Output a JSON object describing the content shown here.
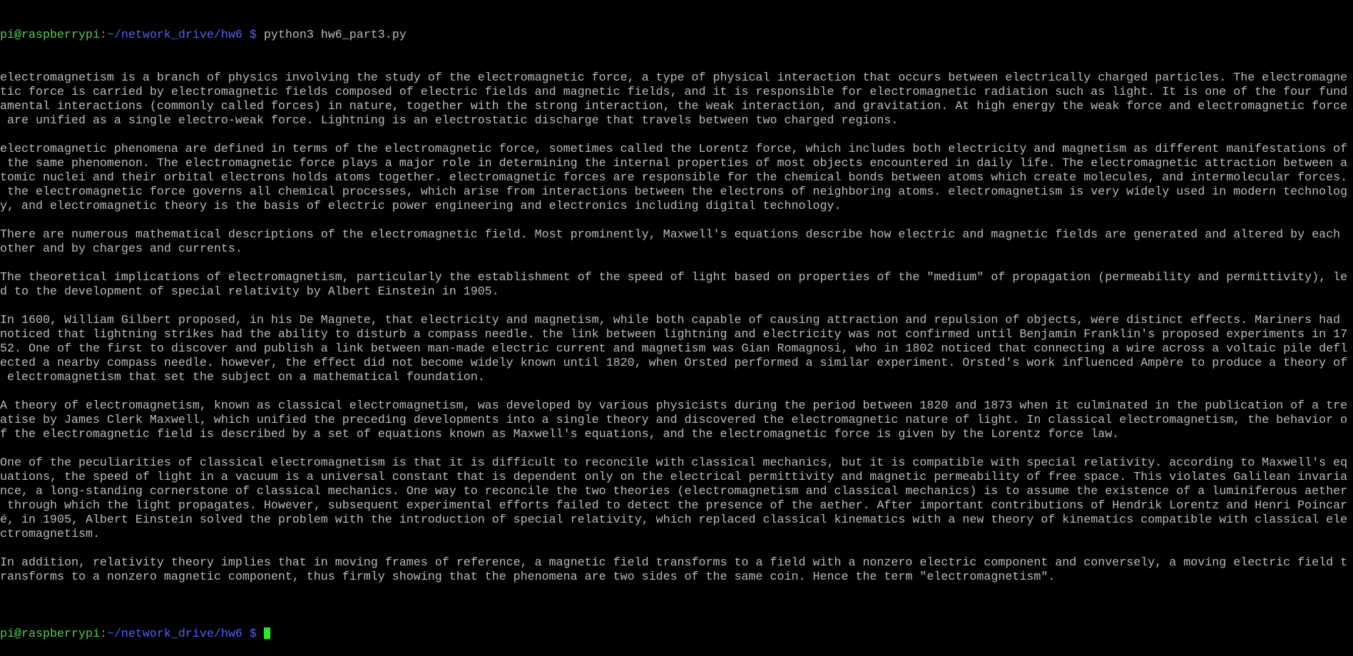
{
  "prompt": {
    "user_host": "pi@raspberrypi",
    "colon": ":",
    "path": "~/network_drive/hw6 $",
    "command": "python3 hw6_part3.py"
  },
  "colors": {
    "user": "#4fd04f",
    "path": "#5060ff",
    "text": "#bbbbbb",
    "cursor": "#22ee22"
  },
  "output": {
    "paragraphs": [
      [
        "electromagnetism is a branch of physics involving the study of the electromagnetic force, a type of physical interaction that occurs between electrically charged particles. The electromagne",
        "tic force is carried by electromagnetic fields composed of electric fields and magnetic fields, and it is responsible for electromagnetic radiation such as light. It is one of the four fund",
        "amental interactions (commonly called forces) in nature, together with the strong interaction, the weak interaction, and gravitation. At high energy the weak force and electromagnetic force",
        " are unified as a single electro-weak force. Lightning is an electrostatic discharge that travels between two charged regions."
      ],
      [
        "electromagnetic phenomena are defined in terms of the electromagnetic force, sometimes called the Lorentz force, which includes both electricity and magnetism as different manifestations of",
        " the same phenomenon. The electromagnetic force plays a major role in determining the internal properties of most objects encountered in daily life. The electromagnetic attraction between a",
        "tomic nuclei and their orbital electrons holds atoms together. electromagnetic forces are responsible for the chemical bonds between atoms which create molecules, and intermolecular forces.",
        " the electromagnetic force governs all chemical processes, which arise from interactions between the electrons of neighboring atoms. electromagnetism is very widely used in modern technolog",
        "y, and electromagnetic theory is the basis of electric power engineering and electronics including digital technology."
      ],
      [
        "There are numerous mathematical descriptions of the electromagnetic field. Most prominently, Maxwell's equations describe how electric and magnetic fields are generated and altered by each",
        "other and by charges and currents."
      ],
      [
        "The theoretical implications of electromagnetism, particularly the establishment of the speed of light based on properties of the \"medium\" of propagation (permeability and permittivity), le",
        "d to the development of special relativity by Albert Einstein in 1905."
      ],
      [
        "In 1600, William Gilbert proposed, in his De Magnete, that electricity and magnetism, while both capable of causing attraction and repulsion of objects, were distinct effects. Mariners had",
        "noticed that lightning strikes had the ability to disturb a compass needle. the link between lightning and electricity was not confirmed until Benjamin Franklin's proposed experiments in 17",
        "52. One of the first to discover and publish a link between man-made electric current and magnetism was Gian Romagnosi, who in 1802 noticed that connecting a wire across a voltaic pile defl",
        "ected a nearby compass needle. however, the effect did not become widely known until 1820, when Orsted performed a similar experiment. Orsted's work influenced Ampère to produce a theory of",
        " electromagnetism that set the subject on a mathematical foundation."
      ],
      [
        "A theory of electromagnetism, known as classical electromagnetism, was developed by various physicists during the period between 1820 and 1873 when it culminated in the publication of a tre",
        "atise by James Clerk Maxwell, which unified the preceding developments into a single theory and discovered the electromagnetic nature of light. In classical electromagnetism, the behavior o",
        "f the electromagnetic field is described by a set of equations known as Maxwell's equations, and the electromagnetic force is given by the Lorentz force law."
      ],
      [
        "One of the peculiarities of classical electromagnetism is that it is difficult to reconcile with classical mechanics, but it is compatible with special relativity. according to Maxwell's eq",
        "uations, the speed of light in a vacuum is a universal constant that is dependent only on the electrical permittivity and magnetic permeability of free space. This violates Galilean invaria",
        "nce, a long-standing cornerstone of classical mechanics. One way to reconcile the two theories (electromagnetism and classical mechanics) is to assume the existence of a luminiferous aether",
        " through which the light propagates. However, subsequent experimental efforts failed to detect the presence of the aether. After important contributions of Hendrik Lorentz and Henri Poincar",
        "é, in 1905, Albert Einstein solved the problem with the introduction of special relativity, which replaced classical kinematics with a new theory of kinematics compatible with classical ele",
        "ctromagnetism."
      ],
      [
        "In addition, relativity theory implies that in moving frames of reference, a magnetic field transforms to a field with a nonzero electric component and conversely, a moving electric field t",
        "ransforms to a nonzero magnetic component, thus firmly showing that the phenomena are two sides of the same coin. Hence the term \"electromagnetism\"."
      ]
    ]
  }
}
